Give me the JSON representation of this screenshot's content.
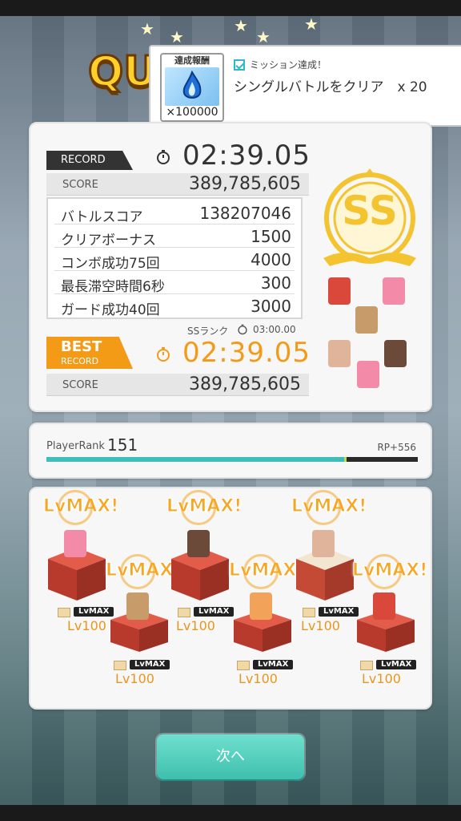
{
  "header": {
    "title_visible": "QU"
  },
  "mission_toast": {
    "reward_label": "達成報酬",
    "reward_count": "×100000",
    "status": "ミッション達成！",
    "description": "シングルバトルをクリア　x 20"
  },
  "record": {
    "tag": "RECORD",
    "time": "02:39.05",
    "score_label": "SCORE",
    "score_value": "389,785,605"
  },
  "breakdown": [
    {
      "label": "バトルスコア",
      "value": "138207046"
    },
    {
      "label": "クリアボーナス",
      "value": "1500"
    },
    {
      "label": "コンボ成功75回",
      "value": "4000"
    },
    {
      "label": "最長滞空時間6秒",
      "value": "300"
    },
    {
      "label": "ガード成功40回",
      "value": "3000"
    }
  ],
  "ss_rank": {
    "label": "SSランク",
    "time": "03:00.00",
    "badge": "SS"
  },
  "best_record": {
    "tag_line1": "BEST",
    "tag_line2": "RECORD",
    "time": "02:39.05",
    "score_label": "SCORE",
    "score_value": "389,785,605"
  },
  "player_rank": {
    "label": "PlayerRank",
    "value": "151",
    "rp": "RP+556",
    "progress": 0.805
  },
  "characters": [
    {
      "lvmax": "LvMAX!",
      "badge": "LvMAX",
      "level": "Lv100",
      "color": "#f28aa8"
    },
    {
      "lvmax": "LvMAX!",
      "badge": "LvMAX",
      "level": "Lv100",
      "color": "#c79b6a"
    },
    {
      "lvmax": "LvMAX!",
      "badge": "LvMAX",
      "level": "Lv100",
      "color": "#6b4a3a"
    },
    {
      "lvmax": "LvMAX!",
      "badge": "LvMAX",
      "level": "Lv100",
      "color": "#f3a25a"
    },
    {
      "lvmax": "LvMAX!",
      "badge": "LvMAX",
      "level": "Lv100",
      "color": "#e0b49a"
    },
    {
      "lvmax": "LvMAX!",
      "badge": "LvMAX",
      "level": "Lv100",
      "color": "#d9483b"
    }
  ],
  "next_button": {
    "label": "次へ"
  },
  "colors": {
    "accent_orange": "#f39a17",
    "accent_teal": "#3fbdb8",
    "gold": "#f4c430"
  }
}
